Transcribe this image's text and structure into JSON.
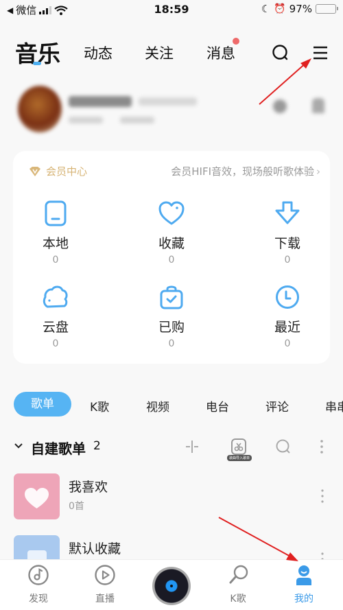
{
  "status_bar": {
    "back_label": "微信",
    "time": "18:59",
    "battery_percent_label": "97%",
    "battery_level": 0.97
  },
  "top_nav": {
    "tabs": [
      {
        "label": "音乐",
        "active": true
      },
      {
        "label": "动态",
        "active": false
      },
      {
        "label": "关注",
        "active": false
      },
      {
        "label": "消息",
        "active": false,
        "has_badge": true
      }
    ],
    "icons": [
      "search-icon",
      "menu-icon"
    ]
  },
  "profile": {
    "blurred": true
  },
  "vip_card": {
    "vip_label": "会员中心",
    "promo_text": "会员HIFI音效，现场般听歌体验",
    "accent": "#d6b374",
    "items": [
      {
        "label": "本地",
        "count": "0",
        "icon": "phone-icon"
      },
      {
        "label": "收藏",
        "count": "0",
        "icon": "heart-icon"
      },
      {
        "label": "下载",
        "count": "0",
        "icon": "download-icon"
      },
      {
        "label": "云盘",
        "count": "0",
        "icon": "cloud-icon"
      },
      {
        "label": "已购",
        "count": "0",
        "icon": "purchased-bag-icon"
      },
      {
        "label": "最近",
        "count": "0",
        "icon": "clock-icon"
      }
    ]
  },
  "section_tabs": [
    {
      "label": "歌单",
      "active": true
    },
    {
      "label": "K歌",
      "active": false
    },
    {
      "label": "视频",
      "active": false
    },
    {
      "label": "电台",
      "active": false
    },
    {
      "label": "评论",
      "active": false
    },
    {
      "label": "串串",
      "active": false
    }
  ],
  "playlists": {
    "title": "自建歌单",
    "count": "2",
    "import_tag": "歌曲导入歌单",
    "items": [
      {
        "name": "我喜欢",
        "sub": "0首",
        "cover_color": "#eea5b8"
      },
      {
        "name": "默认收藏",
        "sub": "",
        "cover_color": "#a9c9ef"
      }
    ]
  },
  "bottom_nav": {
    "items": [
      {
        "label": "发现",
        "active": false
      },
      {
        "label": "直播",
        "active": false
      },
      {
        "label": "",
        "active": false
      },
      {
        "label": "K歌",
        "active": false
      },
      {
        "label": "我的",
        "active": true
      }
    ]
  },
  "colors": {
    "accent_blue": "#56b4f3",
    "icon_blue": "#4eaaf0",
    "badge_red": "#ee6a6a",
    "annotation_red": "#e02020"
  }
}
